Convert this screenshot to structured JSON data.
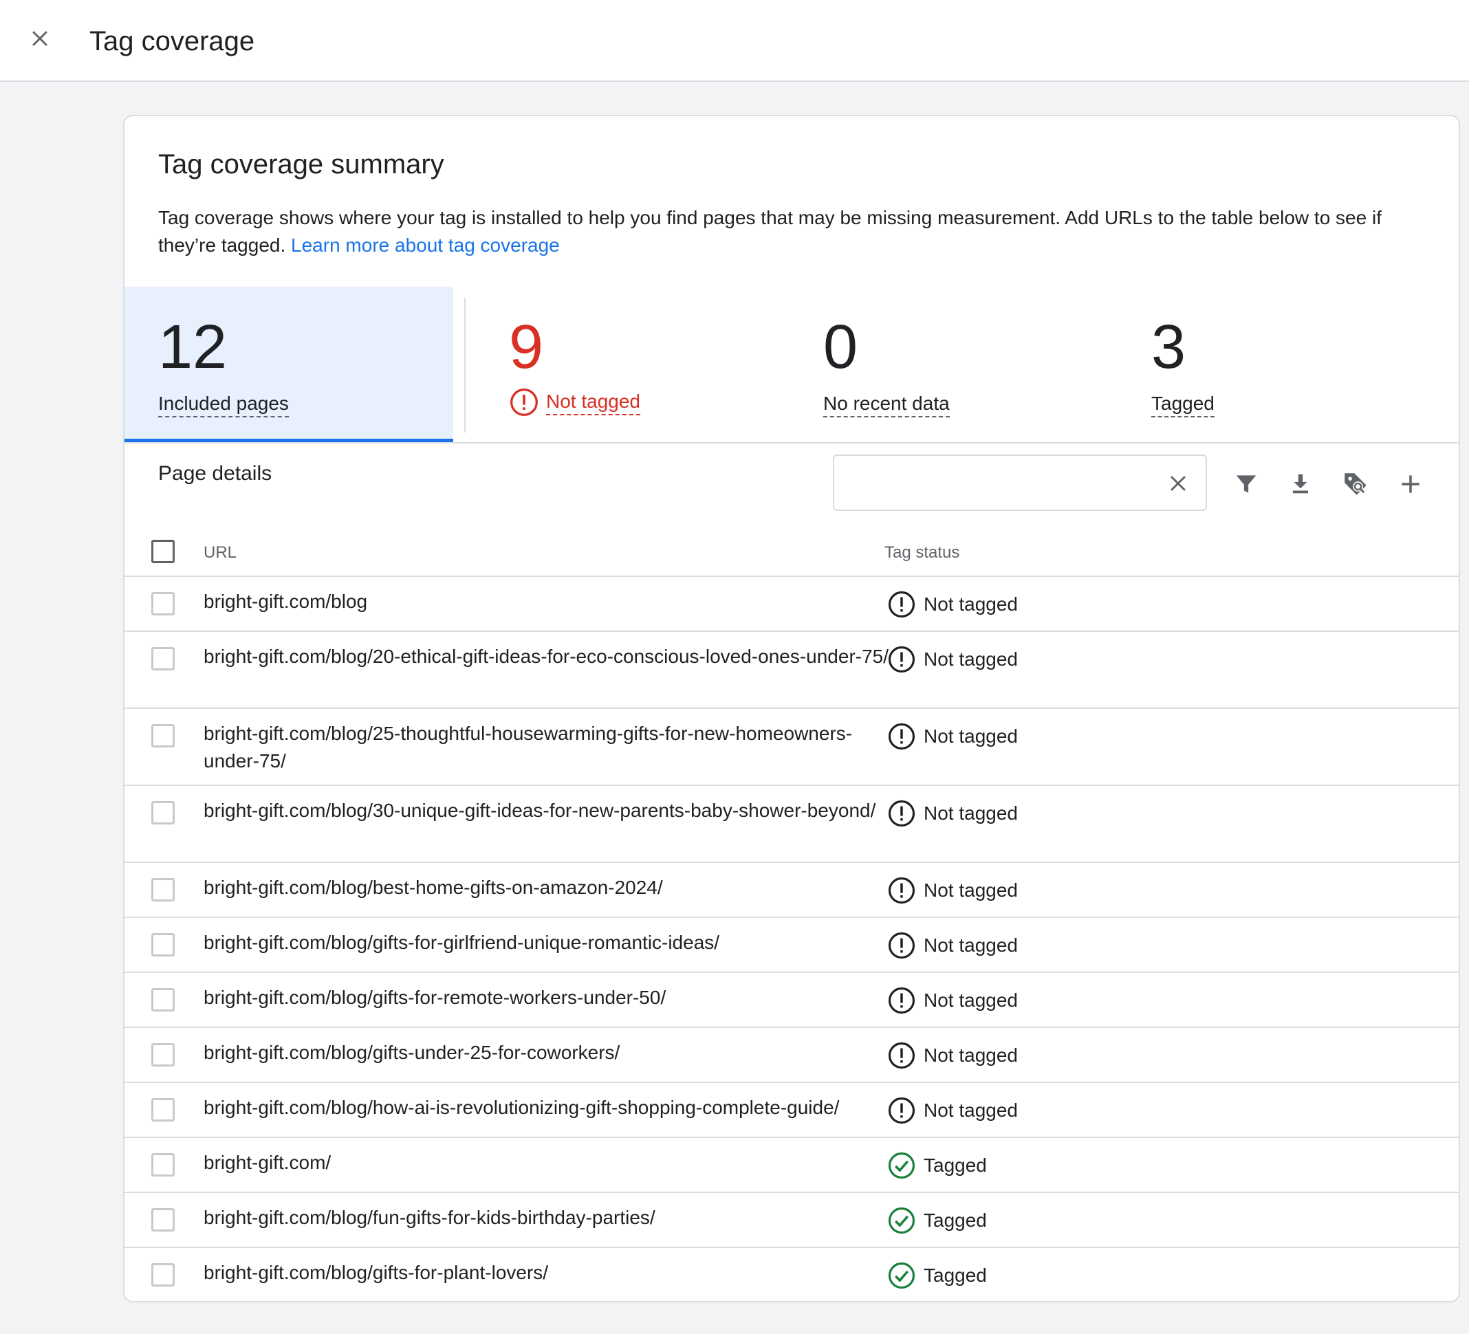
{
  "header": {
    "title": "Tag coverage"
  },
  "summary": {
    "title": "Tag coverage summary",
    "description": "Tag coverage shows where your tag is installed to help you find pages that may be missing measurement. Add URLs to the table below to see if they’re tagged.",
    "learn_more": "Learn more about tag coverage"
  },
  "stats": {
    "included": {
      "value": "12",
      "label": "Included pages"
    },
    "not_tagged": {
      "value": "9",
      "label": "Not tagged"
    },
    "no_recent": {
      "value": "0",
      "label": "No recent data"
    },
    "tagged": {
      "value": "3",
      "label": "Tagged"
    }
  },
  "details": {
    "title": "Page details",
    "search_value": "",
    "columns": {
      "url": "URL",
      "status": "Tag status"
    }
  },
  "rows": [
    {
      "url": "bright-gift.com/blog",
      "status": "Not tagged",
      "kind": "warn"
    },
    {
      "url": "bright-gift.com/blog/20-ethical-gift-ideas-for-eco-conscious-loved-ones-under-75/",
      "status": "Not tagged",
      "kind": "warn"
    },
    {
      "url": "bright-gift.com/blog/25-thoughtful-housewarming-gifts-for-new-homeowners-under-75/",
      "status": "Not tagged",
      "kind": "warn"
    },
    {
      "url": "bright-gift.com/blog/30-unique-gift-ideas-for-new-parents-baby-shower-beyond/",
      "status": "Not tagged",
      "kind": "warn"
    },
    {
      "url": "bright-gift.com/blog/best-home-gifts-on-amazon-2024/",
      "status": "Not tagged",
      "kind": "warn"
    },
    {
      "url": "bright-gift.com/blog/gifts-for-girlfriend-unique-romantic-ideas/",
      "status": "Not tagged",
      "kind": "warn"
    },
    {
      "url": "bright-gift.com/blog/gifts-for-remote-workers-under-50/",
      "status": "Not tagged",
      "kind": "warn"
    },
    {
      "url": "bright-gift.com/blog/gifts-under-25-for-coworkers/",
      "status": "Not tagged",
      "kind": "warn"
    },
    {
      "url": "bright-gift.com/blog/how-ai-is-revolutionizing-gift-shopping-complete-guide/",
      "status": "Not tagged",
      "kind": "warn"
    },
    {
      "url": "bright-gift.com/",
      "status": "Tagged",
      "kind": "ok"
    },
    {
      "url": "bright-gift.com/blog/fun-gifts-for-kids-birthday-parties/",
      "status": "Tagged",
      "kind": "ok"
    },
    {
      "url": "bright-gift.com/blog/gifts-for-plant-lovers/",
      "status": "Tagged",
      "kind": "ok"
    }
  ],
  "colors": {
    "accent": "#1a73e8",
    "warning": "#d93025",
    "success": "#188038",
    "active_bg": "#e8f0fe"
  },
  "icons": {
    "close": "close-icon",
    "warn": "error-outline-icon",
    "ok": "check-circle-icon",
    "filter": "filter-icon",
    "download": "download-icon",
    "tag": "tag-icon",
    "add": "plus-icon"
  }
}
